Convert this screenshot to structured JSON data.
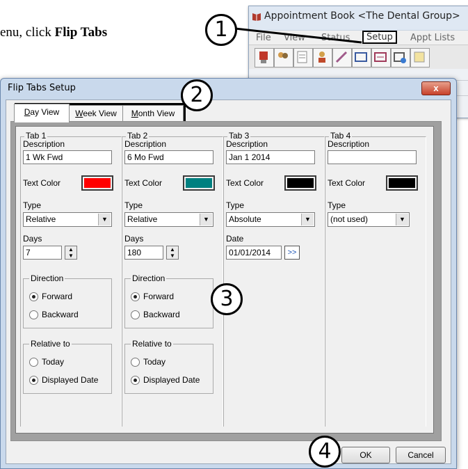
{
  "instruction": {
    "prefix": "enu, click ",
    "bold": "Flip Tabs"
  },
  "app_window": {
    "title": "Appointment Book <The Dental Group>",
    "menu": [
      "File",
      "View",
      "Status",
      "Setup",
      "Appt Lists"
    ]
  },
  "callouts": [
    "1",
    "2",
    "3",
    "4"
  ],
  "dialog": {
    "title": "Flip Tabs Setup",
    "close_label": "x",
    "tabs": [
      {
        "accel": "D",
        "rest": "ay View"
      },
      {
        "accel": "W",
        "rest": "eek View"
      },
      {
        "accel": "M",
        "rest": "onth View"
      }
    ],
    "columns": [
      {
        "legend": "Tab 1",
        "description_label": "Description",
        "description": "1 Wk Fwd",
        "text_color_label": "Text Color",
        "text_color": "#ff0000",
        "type_label": "Type",
        "type": "Relative",
        "days_label": "Days",
        "days": "7",
        "direction_label": "Direction",
        "direction_options": [
          "Forward",
          "Backward"
        ],
        "relative_label": "Relative to",
        "relative_options": [
          "Today",
          "Displayed Date"
        ]
      },
      {
        "legend": "Tab 2",
        "description_label": "Description",
        "description": "6 Mo Fwd",
        "text_color_label": "Text Color",
        "text_color": "#008080",
        "type_label": "Type",
        "type": "Relative",
        "days_label": "Days",
        "days": "180",
        "direction_label": "Direction",
        "direction_options": [
          "Forward",
          "Backward"
        ],
        "relative_label": "Relative to",
        "relative_options": [
          "Today",
          "Displayed Date"
        ]
      },
      {
        "legend": "Tab 3",
        "description_label": "Description",
        "description": "Jan 1 2014",
        "text_color_label": "Text Color",
        "text_color": "#000000",
        "type_label": "Type",
        "type": "Absolute",
        "date_label": "Date",
        "date": "01/01/2014",
        "date_button": ">>"
      },
      {
        "legend": "Tab 4",
        "description_label": "Description",
        "description": "",
        "text_color_label": "Text Color",
        "text_color": "#000000",
        "type_label": "Type",
        "type": "(not used)"
      }
    ],
    "ok_label": "OK",
    "cancel_label": "Cancel"
  }
}
